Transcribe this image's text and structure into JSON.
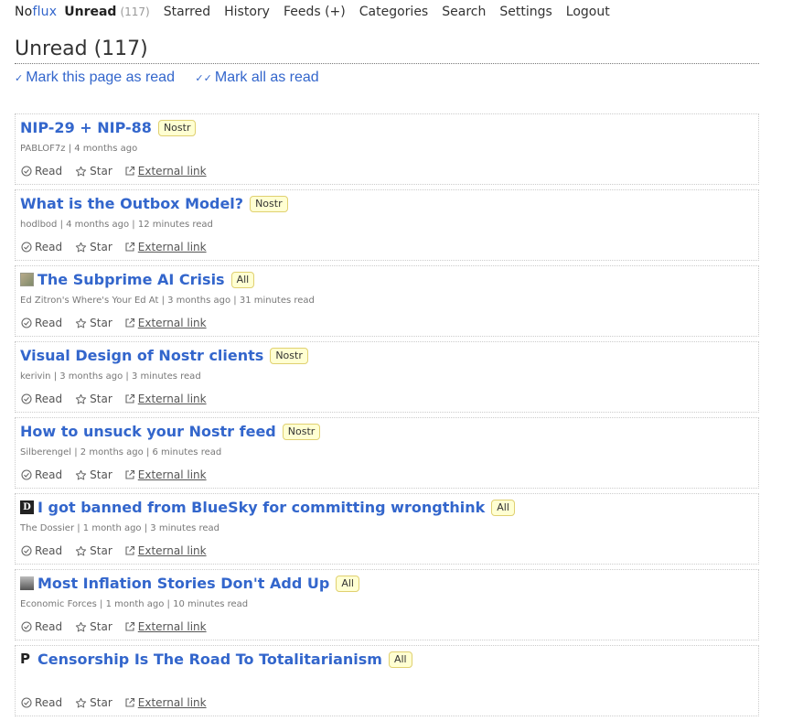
{
  "header": {
    "logo": {
      "part1": "No",
      "part2": "flux"
    },
    "nav": [
      {
        "label": "Unread",
        "count": "(117)",
        "active": true
      },
      {
        "label": "Starred"
      },
      {
        "label": "History"
      },
      {
        "label": "Feeds (+)"
      },
      {
        "label": "Categories"
      },
      {
        "label": "Search"
      },
      {
        "label": "Settings"
      },
      {
        "label": "Logout"
      }
    ]
  },
  "page": {
    "title": "Unread (117)",
    "actions": {
      "mark_page": "Mark this page as read",
      "mark_all": "Mark all as read"
    }
  },
  "entry_buttons": {
    "read": "Read",
    "star": "Star",
    "external": "External link"
  },
  "entries": [
    {
      "title": "NIP-29 + NIP-88",
      "tag": "Nostr",
      "meta": "PABLOF7z | 4 months ago",
      "icon": ""
    },
    {
      "title": "What is the Outbox Model?",
      "tag": "Nostr",
      "meta": "hodlbod | 4 months ago | 12 minutes read",
      "icon": ""
    },
    {
      "title": "The Subprime AI Crisis",
      "tag": "All",
      "meta": "Ed Zitron's Where's Your Ed At | 3 months ago | 31 minutes read",
      "icon": "favicon"
    },
    {
      "title": "Visual Design of Nostr clients",
      "tag": "Nostr",
      "meta": "kerivin | 3 months ago | 3 minutes read",
      "icon": ""
    },
    {
      "title": "How to unsuck your Nostr feed",
      "tag": "Nostr",
      "meta": "Silberengel | 2 months ago | 6 minutes read",
      "icon": ""
    },
    {
      "title": "I got banned from BlueSky for committing wrongthink",
      "tag": "All",
      "meta": "The Dossier | 1 month ago | 3 minutes read",
      "icon": "dossier"
    },
    {
      "title": "Most Inflation Stories Don't Add Up",
      "tag": "All",
      "meta": "Economic Forces | 1 month ago | 10 minutes read",
      "icon": "econ"
    },
    {
      "title": "Censorship Is The Road To Totalitarianism",
      "tag": "All",
      "meta": "",
      "icon": "pletter"
    }
  ],
  "colors": {
    "link": "#3366cc",
    "badge_bg": "#ffffd2",
    "badge_border": "#e0d070"
  }
}
